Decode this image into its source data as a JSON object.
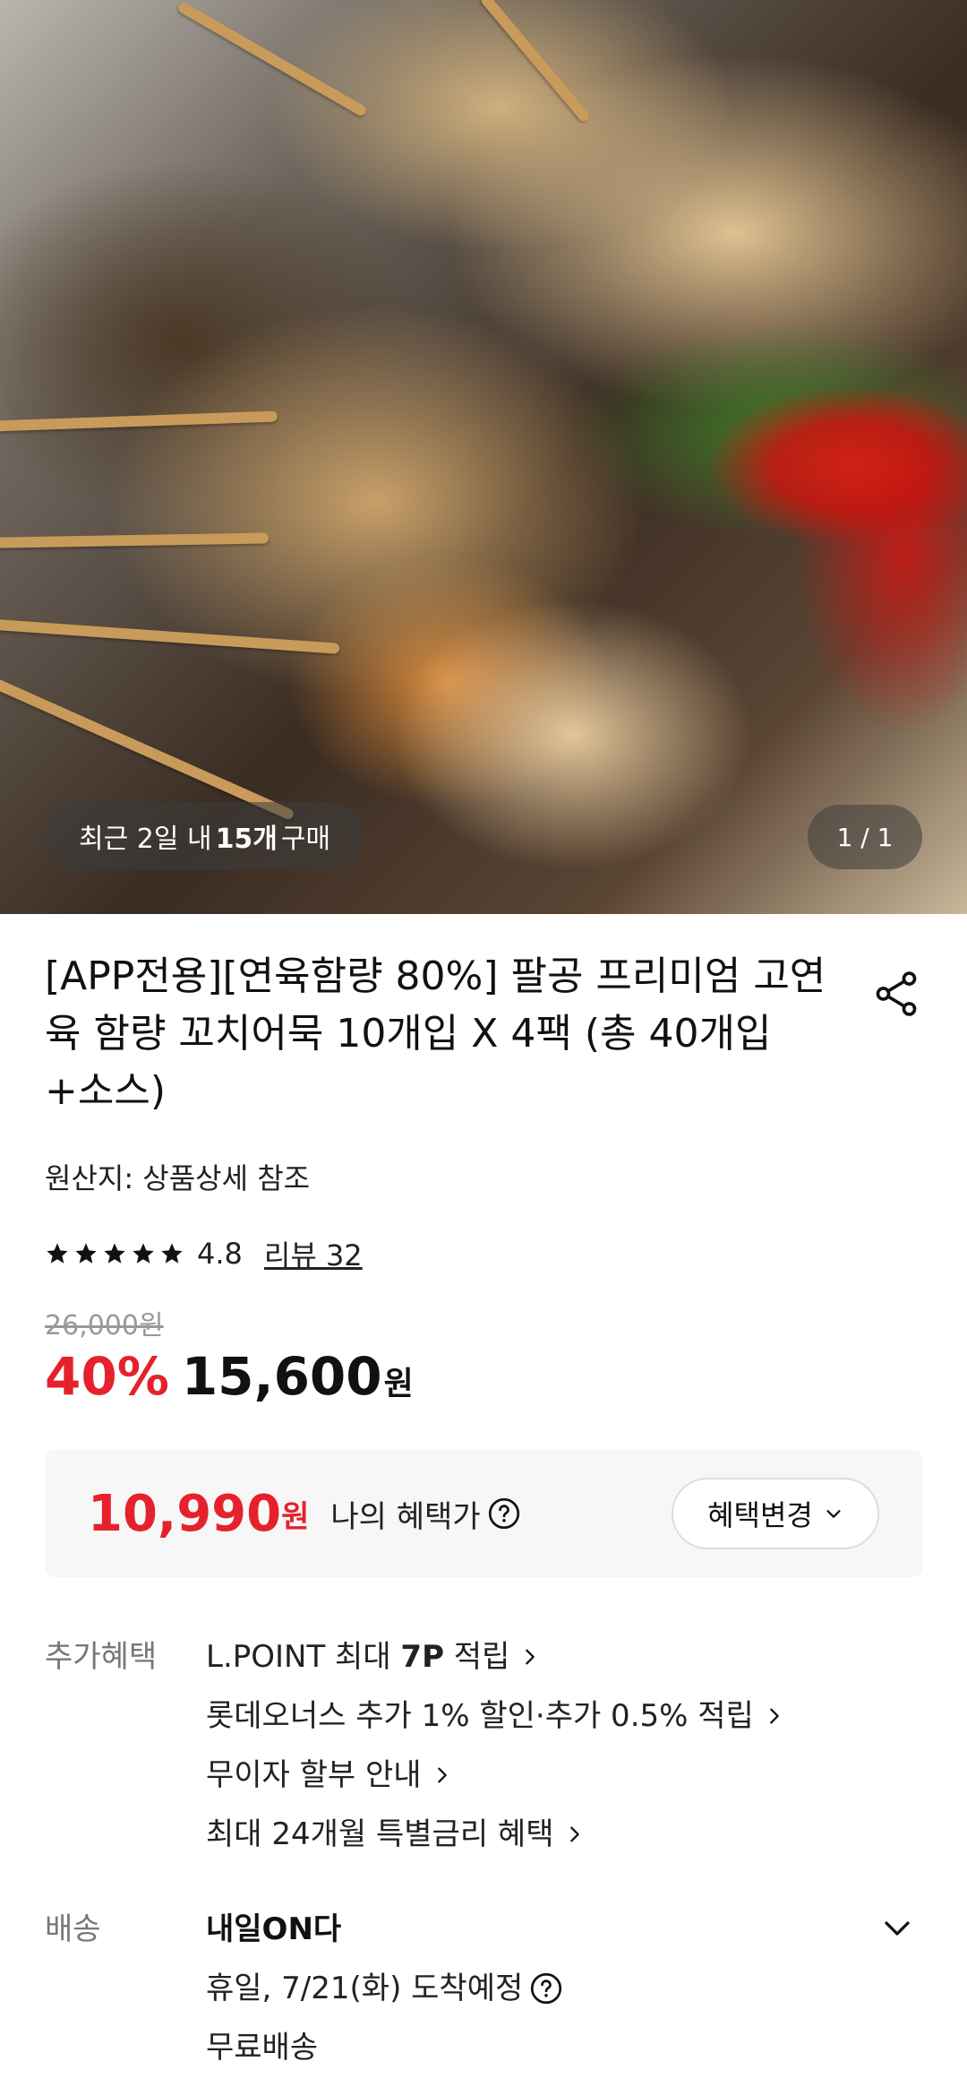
{
  "hero": {
    "purchase_prefix": "최근 2일 내 ",
    "purchase_count": "15개",
    "purchase_suffix": " 구매",
    "counter": "1 / 1"
  },
  "product": {
    "title": "[APP전용][연육함량 80%] 팔공 프리미엄 고연육 함량 꼬치어묵 10개입 X 4팩 (총 40개입+소스)",
    "origin": "원산지: 상품상세 참조",
    "rating": "4.8",
    "stars": 5,
    "review_link": "리뷰 32",
    "original_price": "26,000원",
    "discount": "40%",
    "price": "15,600",
    "price_unit": "원"
  },
  "benefit_box": {
    "price": "10,990",
    "unit": "원",
    "label": "나의 혜택가",
    "change_button": "혜택변경"
  },
  "extra_benefits": {
    "label": "추가혜택",
    "items": [
      {
        "prefix": "L.POINT 최대 ",
        "bold": "7P",
        "suffix": " 적립"
      },
      {
        "text": "롯데오너스 추가 1% 할인·추가 0.5% 적립"
      },
      {
        "text": "무이자 할부 안내"
      },
      {
        "text": "최대 24개월 특별금리 혜택"
      }
    ]
  },
  "shipping": {
    "label": "배송",
    "title": "내일ON다",
    "arrival": "휴일, 7/21(화) 도착예정",
    "fee": "무료배송"
  },
  "colors": {
    "accent_red": "#e5222b",
    "box_bg": "#f7f7f7"
  }
}
